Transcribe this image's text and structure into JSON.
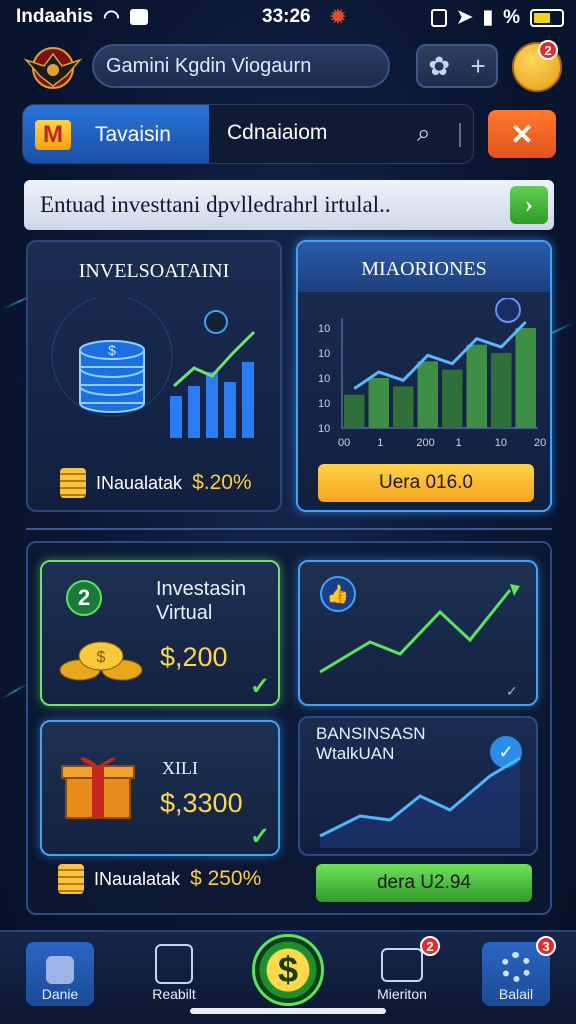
{
  "status": {
    "carrier": "Indaahis",
    "time": "33:26",
    "battery_color": "#f2d21a"
  },
  "header": {
    "search_text": "Gamini Kgdin Viogaurn",
    "avatar_badge": "2"
  },
  "tabs": {
    "active_label": "Tavaisin",
    "active_icon_letter": "M",
    "second_label": "Cdnaiaiom"
  },
  "banner": {
    "text": "Entuad investtani dpvlledrahrl irtulal..",
    "go_icon": "chevron-right-icon"
  },
  "top_cards": {
    "left": {
      "title": "INVELSOATAINI",
      "coin_label": "INaualatak",
      "coin_value": "$.20%"
    },
    "right": {
      "title": "MIAORIONES",
      "y_ticks": [
        "10",
        "10",
        "10",
        "10",
        "10"
      ],
      "x_ticks": [
        "00",
        "1",
        "200",
        "1",
        "10",
        "20"
      ],
      "button_label": "Uera 016.0",
      "bars": [
        2,
        3,
        2.5,
        4,
        3.5,
        5,
        4.5,
        6
      ]
    }
  },
  "investments": [
    {
      "badge": "2",
      "title_line1": "Investasin",
      "title_line2": "Virtual",
      "amount": "$,200"
    },
    {
      "title_line1": "XILI",
      "title_line2": "",
      "amount": "$,3300"
    }
  ],
  "right_panels": {
    "bottom_title_line1": "BANSINSASN",
    "bottom_title_line2": "WtalkUAN"
  },
  "bottom_row": {
    "coin_label": "INaualatak",
    "coin_value": "$ 250%",
    "button_label": "dera U2.94"
  },
  "nav": [
    {
      "label": "Danie",
      "badge": ""
    },
    {
      "label": "Reabilt",
      "badge": ""
    },
    {
      "label": "",
      "badge": ""
    },
    {
      "label": "Mieriton",
      "badge": "2"
    },
    {
      "label": "Balail",
      "badge": "3"
    }
  ]
}
